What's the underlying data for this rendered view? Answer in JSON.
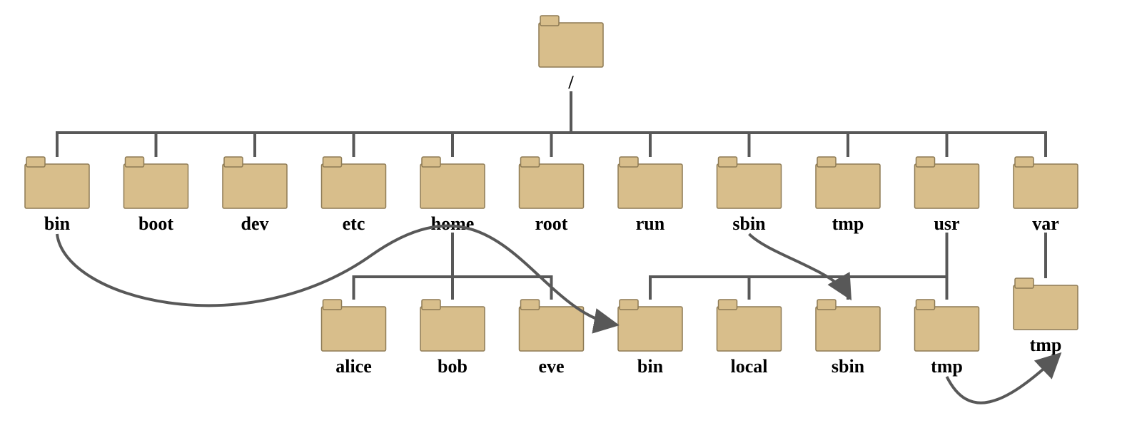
{
  "colors": {
    "folder_fill": "#d8be8b",
    "folder_stroke": "#8d7a54",
    "connector": "#585858"
  },
  "root": {
    "label": "/"
  },
  "level1": [
    {
      "id": "bin",
      "label": "bin"
    },
    {
      "id": "boot",
      "label": "boot"
    },
    {
      "id": "dev",
      "label": "dev"
    },
    {
      "id": "etc",
      "label": "etc"
    },
    {
      "id": "home",
      "label": "home"
    },
    {
      "id": "root",
      "label": "root"
    },
    {
      "id": "run",
      "label": "run"
    },
    {
      "id": "sbin",
      "label": "sbin"
    },
    {
      "id": "tmp",
      "label": "tmp"
    },
    {
      "id": "usr",
      "label": "usr"
    },
    {
      "id": "var",
      "label": "var"
    }
  ],
  "home_children": [
    {
      "id": "alice",
      "label": "alice"
    },
    {
      "id": "bob",
      "label": "bob"
    },
    {
      "id": "eve",
      "label": "eve"
    }
  ],
  "usr_children": [
    {
      "id": "usr_bin",
      "label": "bin"
    },
    {
      "id": "usr_local",
      "label": "local"
    },
    {
      "id": "usr_sbin",
      "label": "sbin"
    },
    {
      "id": "usr_tmp",
      "label": "tmp"
    }
  ],
  "var_children": [
    {
      "id": "var_tmp",
      "label": "tmp"
    }
  ],
  "symlinks": [
    {
      "from": "bin",
      "to": "usr_bin"
    },
    {
      "from": "sbin",
      "to": "usr_sbin"
    },
    {
      "from": "usr_tmp",
      "to": "var_tmp"
    }
  ]
}
